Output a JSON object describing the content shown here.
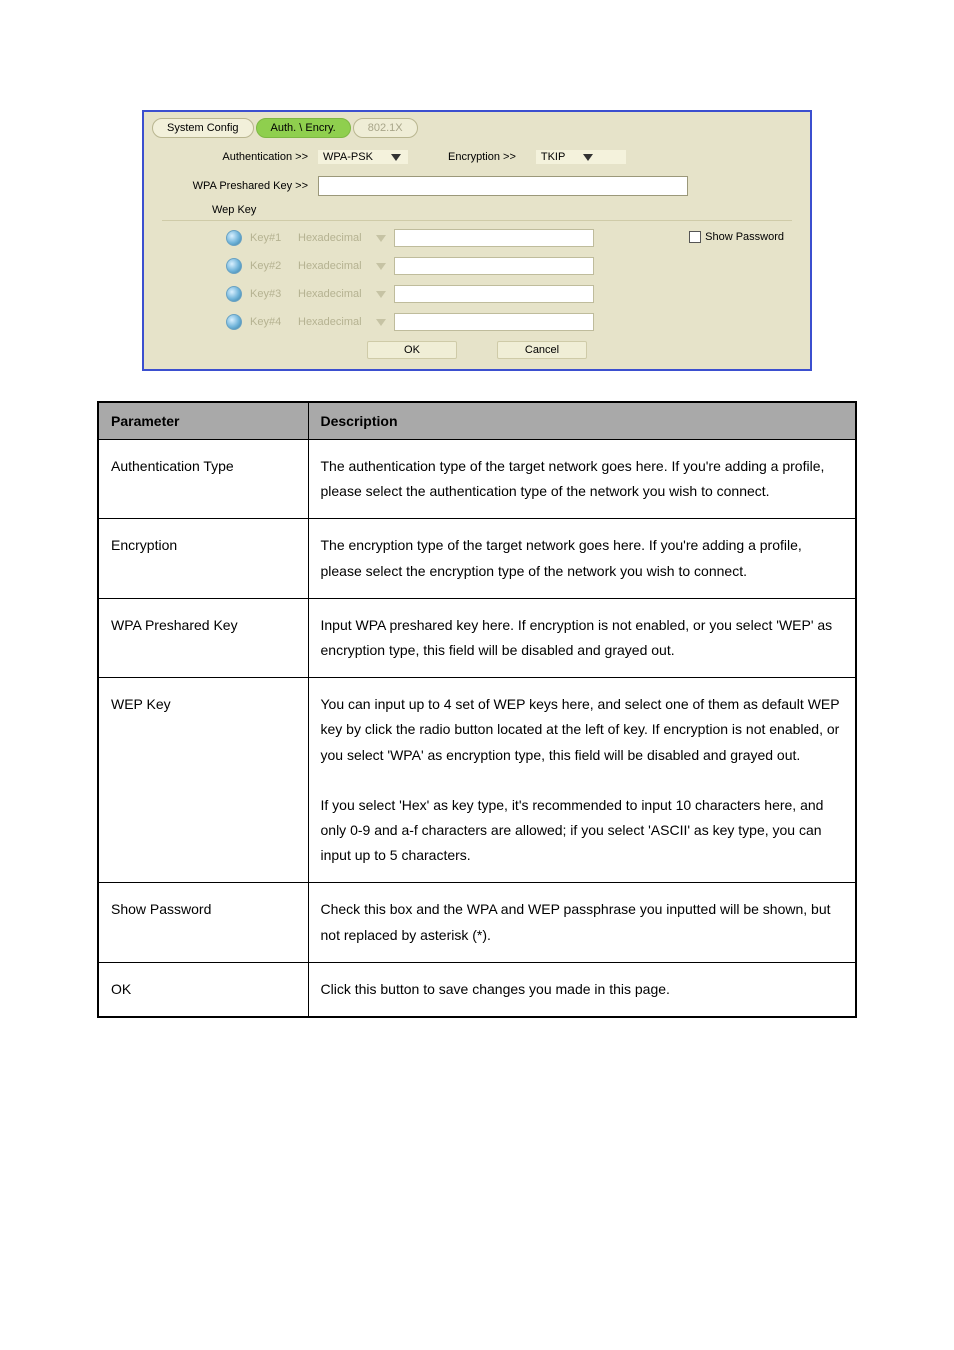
{
  "tabs": {
    "system_config": "System Config",
    "auth_encry": "Auth. \\ Encry.",
    "dot1x": "802.1X"
  },
  "auth": {
    "label": "Authentication >>",
    "value": "WPA-PSK"
  },
  "encryption": {
    "label": "Encryption >>",
    "value": "TKIP"
  },
  "psk": {
    "label": "WPA Preshared Key >>",
    "value": ""
  },
  "wep": {
    "header": "Wep Key",
    "rows": [
      {
        "label": "Key#1",
        "format": "Hexadecimal",
        "value": ""
      },
      {
        "label": "Key#2",
        "format": "Hexadecimal",
        "value": ""
      },
      {
        "label": "Key#3",
        "format": "Hexadecimal",
        "value": ""
      },
      {
        "label": "Key#4",
        "format": "Hexadecimal",
        "value": ""
      }
    ],
    "show_pass_label": "Show Password"
  },
  "buttons": {
    "ok": "OK",
    "cancel": "Cancel"
  },
  "table": {
    "headers": [
      "Parameter",
      "Description"
    ],
    "rows": [
      [
        "Authentication Type",
        "The authentication type of the target network goes here. If you're adding a profile, please select the authentication type of the network you wish to connect."
      ],
      [
        "Encryption",
        "The encryption type of the target network goes here. If you're adding a profile, please select the encryption type of the network you wish to connect."
      ],
      [
        "WPA Preshared Key",
        "Input WPA preshared key here. If encryption is not enabled, or you select 'WEP' as encryption type, this field will be disabled and grayed out."
      ],
      [
        "WEP Key",
        "You can input up to 4 set of WEP keys here, and select one of them as default WEP key by click the radio button located at the left of key. If encryption is not enabled, or you select 'WPA' as encryption type, this field will be disabled and grayed out.\n\nIf you select 'Hex' as key type, it's recommended to input 10 characters here, and only 0-9 and a-f characters are allowed; if you select 'ASCII' as key type, you can input up to 5 characters."
      ],
      [
        "Show Password",
        "Check this box and the WPA and WEP passphrase you inputted will be shown, but not replaced by asterisk (*)."
      ],
      [
        "OK",
        "Click this button to save changes you made in this page."
      ]
    ]
  }
}
